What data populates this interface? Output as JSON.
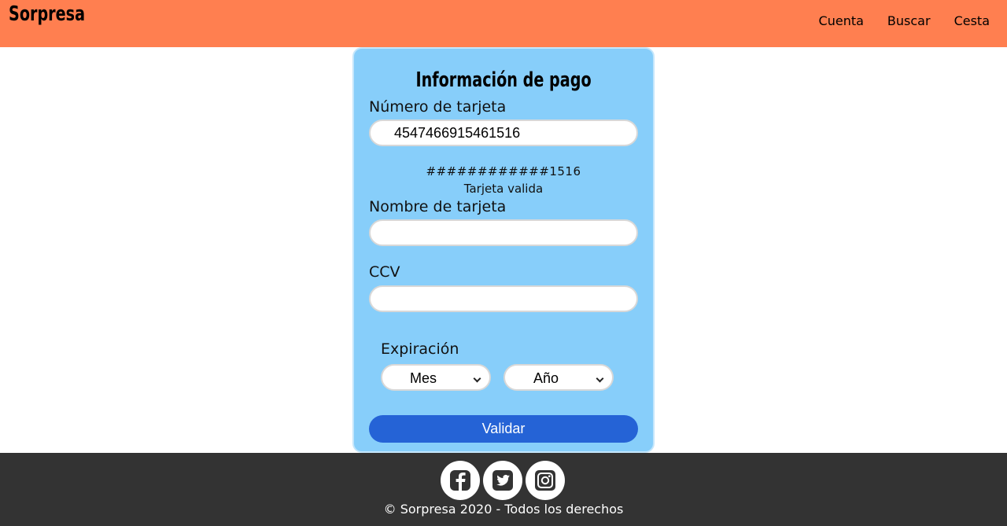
{
  "header": {
    "logo": "Sorpresa",
    "nav": [
      "Cuenta",
      "Buscar",
      "Cesta"
    ]
  },
  "form": {
    "title": "Información de pago",
    "card_number_label": "Número de tarjeta",
    "card_number_value": "4547466915461516",
    "masked_number": "############1516",
    "validity_message": "Tarjeta valida",
    "card_name_label": "Nombre de tarjeta",
    "card_name_value": "",
    "ccv_label": "CCV",
    "ccv_value": "",
    "expiration_label": "Expiración",
    "month_select": "Mes",
    "year_select": "Año",
    "submit_label": "Validar"
  },
  "footer": {
    "social_icons": [
      "facebook-icon",
      "twitter-icon",
      "instagram-icon"
    ],
    "copyright": "© Sorpresa 2020 - Todos los derechos"
  },
  "colors": {
    "header_bg": "#ff7f50",
    "card_bg": "#87cefa",
    "button_bg": "#2563d6",
    "footer_bg": "#333333"
  }
}
